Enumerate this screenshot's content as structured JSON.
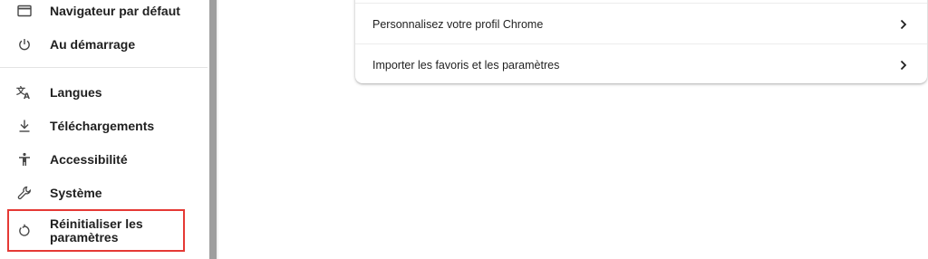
{
  "sidebar": {
    "items": [
      {
        "label": "Navigateur par défaut",
        "icon": "browser-window-icon"
      },
      {
        "label": "Au démarrage",
        "icon": "power-icon"
      },
      {
        "label": "Langues",
        "icon": "translate-icon"
      },
      {
        "label": "Téléchargements",
        "icon": "download-icon"
      },
      {
        "label": "Accessibilité",
        "icon": "accessibility-icon"
      },
      {
        "label": "Système",
        "icon": "wrench-icon"
      },
      {
        "label": "Réinitialiser les paramètres",
        "icon": "reset-icon"
      }
    ],
    "highlighted_item": "Réinitialiser les paramètres",
    "highlight_color": "#e53935"
  },
  "main": {
    "rows": [
      {
        "label": "Personnalisez votre profil Chrome",
        "icon": "chevron-right-icon"
      },
      {
        "label": "Importer les favoris et les paramètres",
        "icon": "chevron-right-icon"
      }
    ]
  }
}
